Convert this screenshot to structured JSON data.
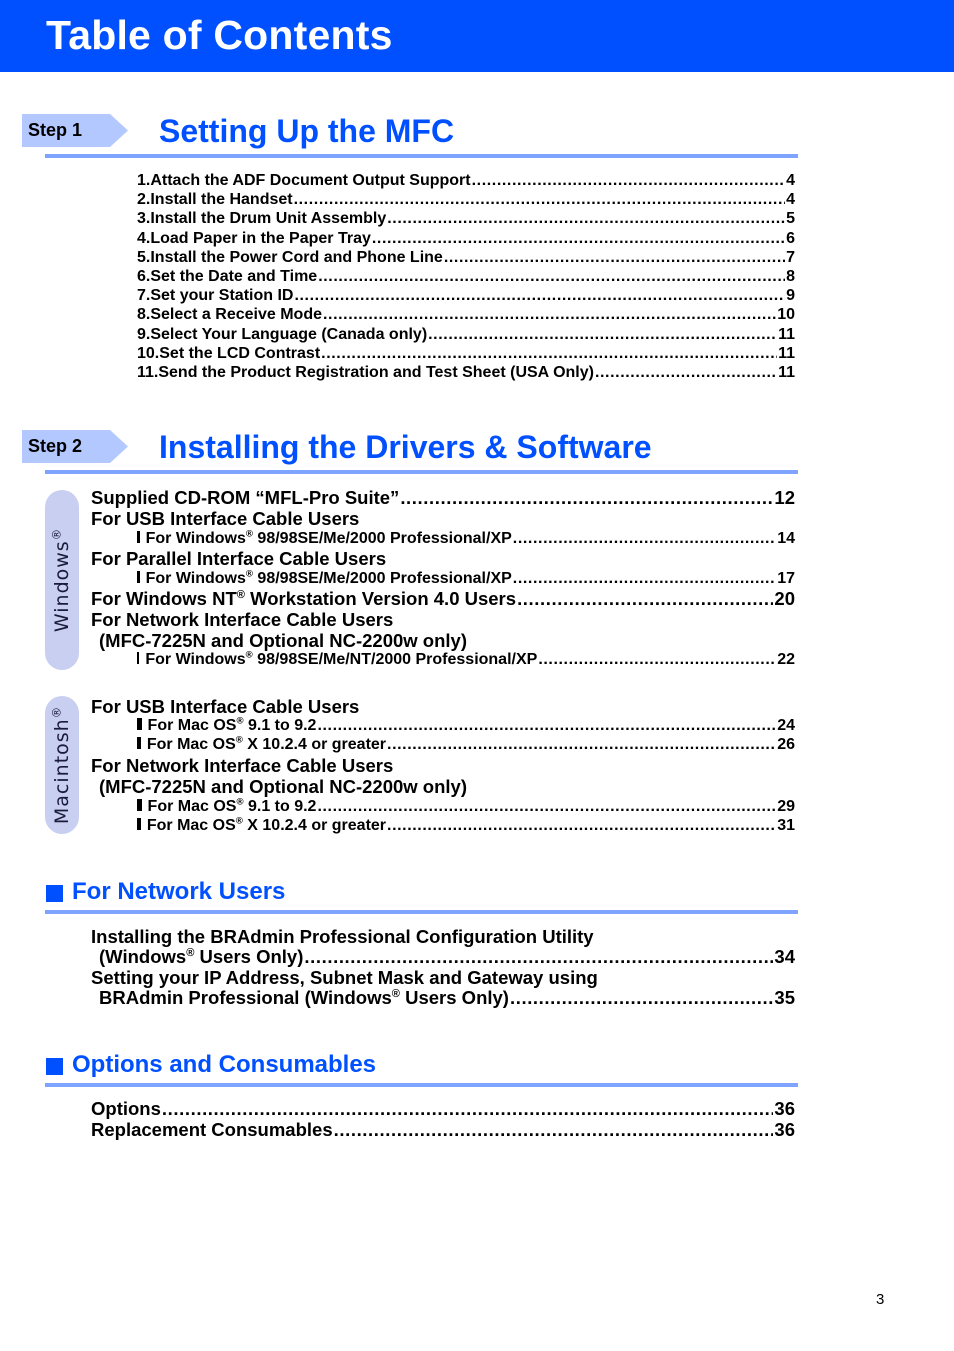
{
  "header": {
    "title": "Table of Contents"
  },
  "colors": {
    "brand_blue": "#0050ff",
    "rule_blue": "#7fa4ff",
    "step_tag": "#b3c8ff",
    "os_pill": "#c8cff0"
  },
  "step1": {
    "tag": "Step 1",
    "title": "Setting Up the MFC",
    "items": [
      {
        "num": "1.",
        "text": "Attach the ADF Document Output Support",
        "page": "4"
      },
      {
        "num": "2.",
        "text": "Install the Handset",
        "page": "4"
      },
      {
        "num": "3.",
        "text": "Install the Drum Unit Assembly",
        "page": "5"
      },
      {
        "num": "4.",
        "text": "Load Paper in the Paper Tray",
        "page": "6"
      },
      {
        "num": "5.",
        "text": "Install the Power Cord and Phone Line",
        "page": "7"
      },
      {
        "num": "6.",
        "text": "Set the Date and Time",
        "page": "8"
      },
      {
        "num": "7.",
        "text": "Set your Station ID",
        "page": "9"
      },
      {
        "num": "8.",
        "text": "Select a Receive Mode",
        "page": "10"
      },
      {
        "num": "9.",
        "text": "Select Your Language (Canada only)",
        "page": "11"
      },
      {
        "num": "10.",
        "text": "Set the LCD Contrast",
        "page": "11"
      },
      {
        "num": "11.",
        "text": "Send the Product Registration and Test Sheet (USA Only)",
        "page": "11"
      }
    ]
  },
  "step2": {
    "tag": "Step 2",
    "title": "Installing the Drivers & Software",
    "windows": {
      "pill_label": "Windows",
      "pill_mark": "®",
      "cdrom": {
        "text": "Supplied CD-ROM “MFL-Pro Suite”",
        "page": "12"
      },
      "usb_heading": "For USB Interface Cable Users",
      "usb_item": {
        "pre": "For Windows",
        "mark": "®",
        "post": " 98/98SE/Me/2000 Professional/XP",
        "page": "14"
      },
      "parallel_heading": "For Parallel Interface Cable Users",
      "parallel_item": {
        "pre": "For Windows",
        "mark": "®",
        "post": " 98/98SE/Me/2000 Professional/XP",
        "page": "17"
      },
      "nt": {
        "pre": "For Windows NT",
        "mark": "®",
        "post": " Workstation Version 4.0 Users",
        "page": "20"
      },
      "network_heading": "For Network Interface Cable Users",
      "network_sub": "(MFC-7225N and Optional NC-2200w only)",
      "network_item": {
        "pre": "For Windows",
        "mark": "®",
        "post": " 98/98SE/Me/NT/2000 Professional/XP",
        "page": "22"
      }
    },
    "mac": {
      "pill_label": "Macintosh",
      "pill_mark": "®",
      "usb_heading": "For USB Interface Cable Users",
      "usb_items": [
        {
          "pre": "For Mac OS",
          "mark": "®",
          "post": " 9.1 to 9.2",
          "page": "24"
        },
        {
          "pre": "For Mac OS",
          "mark": "®",
          "post": " X 10.2.4 or greater",
          "page": "26"
        }
      ],
      "network_heading": "For Network Interface Cable Users",
      "network_sub": "(MFC-7225N and Optional NC-2200w only)",
      "network_items": [
        {
          "pre": "For Mac OS",
          "mark": "®",
          "post": " 9.1 to 9.2",
          "page": "29"
        },
        {
          "pre": "For Mac OS",
          "mark": "®",
          "post": " X 10.2.4 or greater",
          "page": "31"
        }
      ]
    }
  },
  "network_users": {
    "title": "For Network Users",
    "items": [
      {
        "line1": "Installing the BRAdmin Professional Configuration Utility",
        "line2_pre": "(Windows",
        "mark": "®",
        "line2_post": " Users Only)",
        "page": "34"
      },
      {
        "line1": "Setting your IP Address, Subnet Mask and Gateway using",
        "line2_pre": "BRAdmin Professional (Windows",
        "mark": "®",
        "line2_post": " Users Only)",
        "page": "35"
      }
    ]
  },
  "options": {
    "title": "Options and Consumables",
    "items": [
      {
        "text": "Options",
        "page": "36"
      },
      {
        "text": "Replacement Consumables",
        "page": "36"
      }
    ]
  },
  "footer": {
    "page_number": "3"
  }
}
